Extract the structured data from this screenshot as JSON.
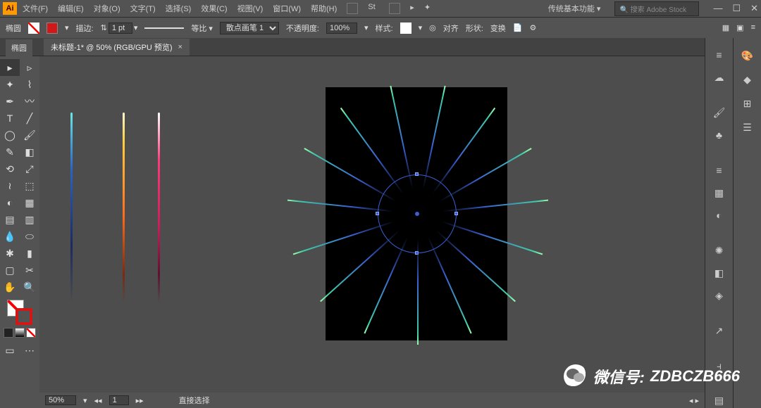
{
  "app": {
    "logo": "Ai"
  },
  "menu": {
    "file": "文件(F)",
    "edit": "编辑(E)",
    "object": "对象(O)",
    "type": "文字(T)",
    "select": "选择(S)",
    "effect": "效果(C)",
    "view": "视图(V)",
    "window": "窗口(W)",
    "help": "帮助(H)"
  },
  "workspace": {
    "label": "传统基本功能"
  },
  "search": {
    "placeholder": "搜索 Adobe Stock"
  },
  "options": {
    "tool_hint": "椭圆",
    "stroke_label": "描边:",
    "stroke_weight": "1 pt",
    "uniform": "等比",
    "brush_name": "散点画笔 1",
    "opacity_label": "不透明度:",
    "opacity_value": "100%",
    "style_label": "样式:",
    "align_label": "对齐",
    "shape_label": "形状:",
    "transform_label": "变换",
    "doc_setup": "📄",
    "prefs": "⚙"
  },
  "document": {
    "tab_title": "未标题-1* @ 50% (RGB/GPU 预览)",
    "close": "×"
  },
  "status": {
    "zoom": "50%",
    "artboard_nav": "1",
    "tool": "直接选择"
  },
  "watermark": {
    "label": "微信号:",
    "id": "ZDBCZB666"
  }
}
